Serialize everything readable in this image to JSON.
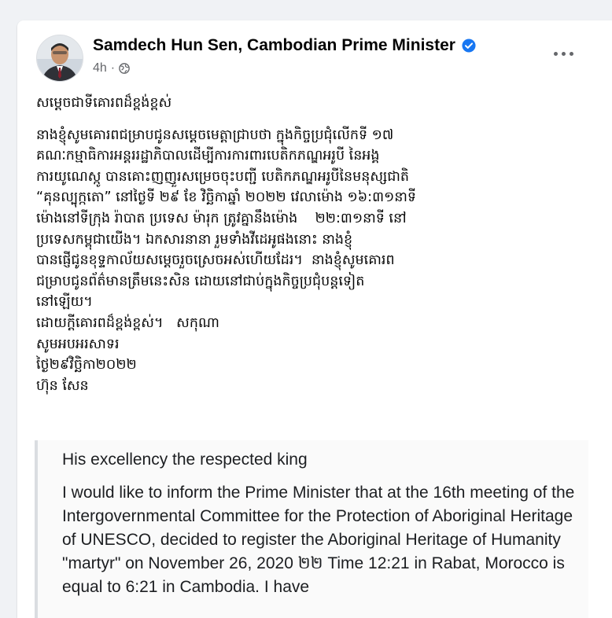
{
  "post": {
    "author": "Samdech Hun Sen, Cambodian Prime Minister",
    "time": "4h",
    "separator": "·",
    "icons": {
      "verified": "verified-badge-icon",
      "audience": "globe-icon",
      "more": "more-options-icon"
    },
    "colors": {
      "verified": "#1877f2",
      "meta": "#65676b",
      "text": "#050505"
    },
    "khmer_lines": [
      "សម្តេចជាទីគោរពដ៏ខ្ពង់ខ្ពស់",
      "នាងខ្ញុំសូមគោរពជម្រាបជូនសម្តេចមេត្តាជ្រាបថា ក្នុងកិច្ចប្រជុំលើកទី ១៧",
      "គណៈកម្មាធិការអន្តររដ្ឋាភិបាលដើម្បីការការពារបេតិកភណ្ឌអរូបី នៃអង្គ",
      "ការយូណេស្កូ បានគោះញញួរសម្រេចចុះបញ្ជី បេតិកភណ្ឌអរូបីនៃមនុស្សជាតិ",
      "“គុនល្បុក្កតោ” នៅថ្ងៃទី ២៩ ខែ វិច្ឆិកាឆ្នាំ ២០២២ វេលាម៉ោង ១៦:៣១នាទី",
      "ម៉ោងនៅទីក្រុង រ៉ាបាត ប្រទេស ម៉ារុក ត្រូវគ្នានឹងម៉ោង    ២២:៣១នាទី នៅ",
      "ប្រទេសកម្ពុជាយើង។ ឯកសារនានា រួមទាំងវីដេអូផងនោះ នាងខ្ញុំ",
      "បានផ្ញើជូនខុទ្ទកាល័យសម្តេចរួចស្រេចអស់ហើយដែរ។  នាងខ្ញុំសូមគោរព",
      "ជម្រាបជូនព័ត៌មានត្រឹមនេះសិន ដោយនៅជាប់ក្នុងកិច្ចប្រជុំបន្តទៀត",
      "នៅឡើយ។",
      "ដោយក្តីគោរពដ៏ខ្ពង់ខ្ពស់។   សកុណា",
      "សូមអបអរសាទរ",
      "ថ្ងៃ២៩វិច្ឆិកា២០២២",
      "ហ៊ុន សែន"
    ],
    "translation": {
      "greeting": "His excellency the respected king",
      "body": "I would like to inform the Prime Minister that at the 16th meeting of the Intergovernmental Committee for the Protection of Aboriginal Heritage of UNESCO, decided to register the Aboriginal Heritage of Humanity \"martyr\" on November 26, 2020 ២២ Time 12:21 in Rabat, Morocco is equal to 6:21 in Cambodia. I have"
    }
  }
}
